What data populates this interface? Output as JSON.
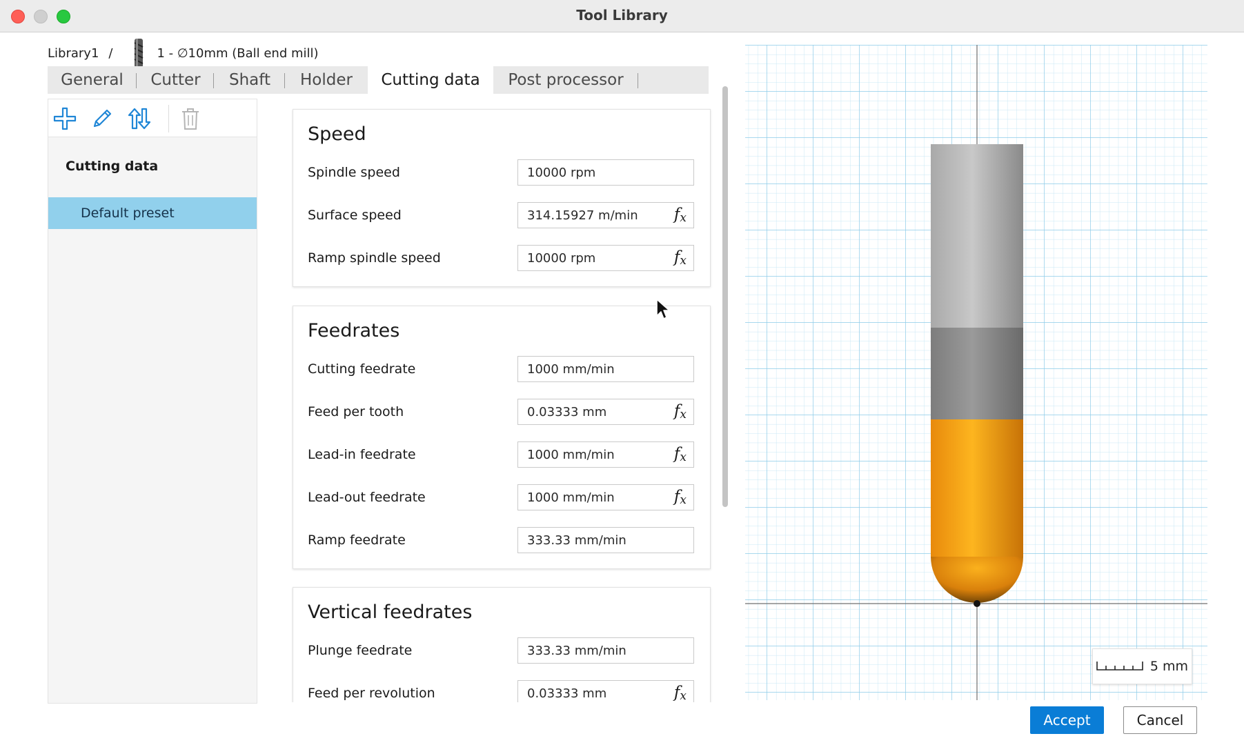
{
  "window": {
    "title": "Tool Library"
  },
  "breadcrumb": {
    "library": "Library1",
    "separator": "/",
    "tool": "1 - ∅10mm (Ball end mill)"
  },
  "tabs": [
    {
      "label": "General"
    },
    {
      "label": "Cutter"
    },
    {
      "label": "Shaft"
    },
    {
      "label": "Holder"
    },
    {
      "label": "Cutting data",
      "active": true
    },
    {
      "label": "Post processor"
    }
  ],
  "presets": {
    "toolbar_icons": [
      "add-icon",
      "edit-icon",
      "sort-icon",
      "delete-icon"
    ],
    "header": "Cutting data",
    "items": [
      {
        "label": "Default preset",
        "selected": true
      }
    ]
  },
  "sections": {
    "speed": {
      "title": "Speed",
      "rows": [
        {
          "label": "Spindle speed",
          "value": "10000 rpm",
          "fx": false
        },
        {
          "label": "Surface speed",
          "value": "314.15927 m/min",
          "fx": true
        },
        {
          "label": "Ramp spindle speed",
          "value": "10000 rpm",
          "fx": true
        }
      ]
    },
    "feedrates": {
      "title": "Feedrates",
      "rows": [
        {
          "label": "Cutting feedrate",
          "value": "1000 mm/min",
          "fx": false
        },
        {
          "label": "Feed per tooth",
          "value": "0.03333 mm",
          "fx": true
        },
        {
          "label": "Lead-in feedrate",
          "value": "1000 mm/min",
          "fx": true
        },
        {
          "label": "Lead-out feedrate",
          "value": "1000 mm/min",
          "fx": true
        },
        {
          "label": "Ramp feedrate",
          "value": "333.33 mm/min",
          "fx": false
        }
      ]
    },
    "vertical": {
      "title": "Vertical feedrates",
      "rows": [
        {
          "label": "Plunge feedrate",
          "value": "333.33 mm/min",
          "fx": false
        },
        {
          "label": "Feed per revolution",
          "value": "0.03333 mm",
          "fx": true
        }
      ]
    }
  },
  "fx_symbol": "f",
  "fx_sub": "x",
  "preview": {
    "scale_label": "5 mm",
    "colors": {
      "grid": "#9fd6ee",
      "cutter": "#f7a418",
      "shaft": "#8e8e8e",
      "holder": "#bdbdbd"
    }
  },
  "buttons": {
    "accept": "Accept",
    "cancel": "Cancel"
  },
  "colors": {
    "accent": "#0a7dd6",
    "selected_preset": "#91d0ec"
  }
}
